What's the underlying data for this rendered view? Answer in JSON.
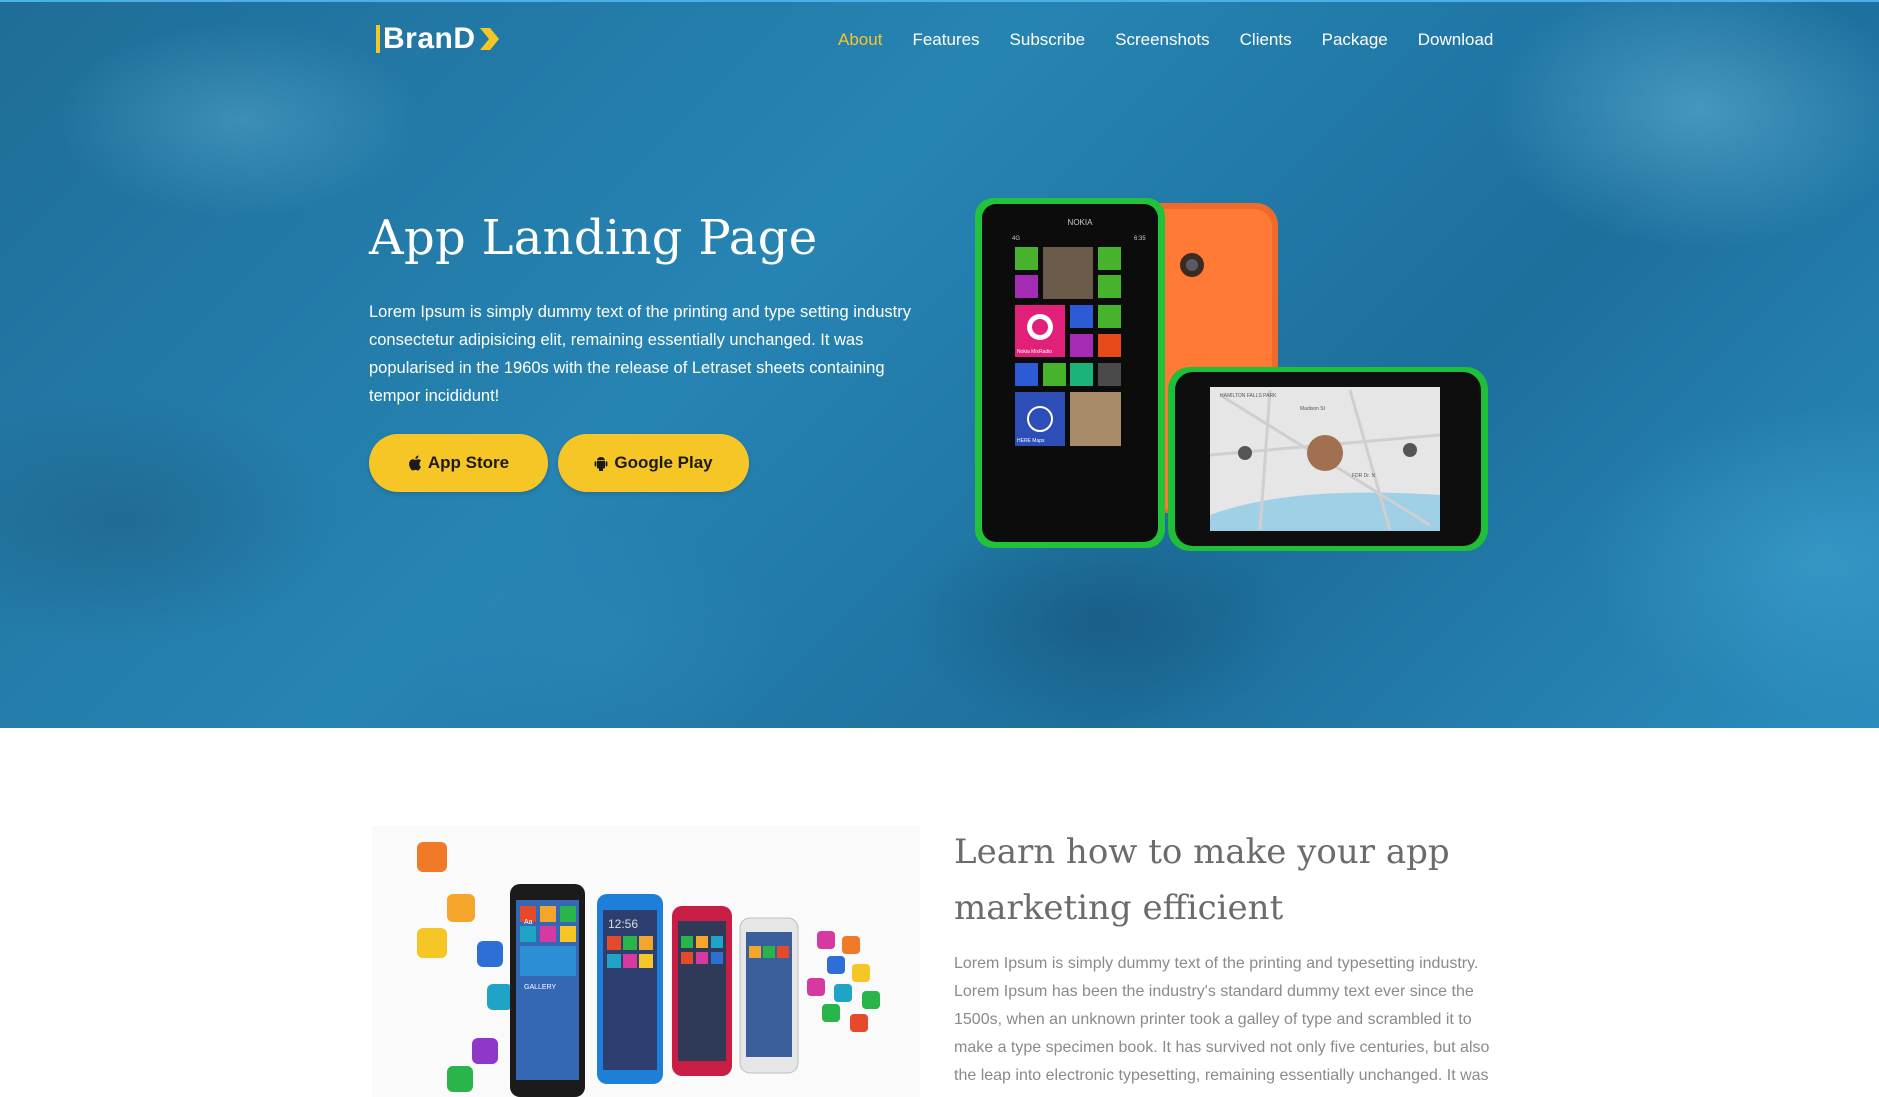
{
  "brand": {
    "logo_text": "BranD",
    "accent": "#f6c626"
  },
  "nav": {
    "items": [
      {
        "label": "About",
        "active": true
      },
      {
        "label": "Features",
        "active": false
      },
      {
        "label": "Subscribe",
        "active": false
      },
      {
        "label": "Screenshots",
        "active": false
      },
      {
        "label": "Clients",
        "active": false
      },
      {
        "label": "Package",
        "active": false
      },
      {
        "label": "Download",
        "active": false
      }
    ]
  },
  "hero": {
    "title": "App Landing Page",
    "text": "Lorem Ipsum is simply dummy text of the printing and type setting industry consectetur adipisicing elit, remaining essentially unchanged. It was popularised in the 1960s with the release of Letraset sheets containing tempor incididunt!",
    "buttons": {
      "app_store": {
        "label": "App Store",
        "icon": "apple-icon"
      },
      "google_play": {
        "label": "Google Play",
        "icon": "android-icon"
      }
    },
    "phone_brand": "NOKIA",
    "tile_labels": {
      "mixradio": "Nokia MixRadio",
      "maps": "HERE Maps"
    },
    "map_labels": [
      "HAMILTON FALLS PARK",
      "FDR Dr. N",
      "Madison St"
    ],
    "phone_status": {
      "signal": "4G",
      "time": "6:35"
    }
  },
  "features_section": {
    "title": "Learn how to make your app marketing efficient",
    "text": "Lorem Ipsum is simply dummy text of the printing and typesetting industry. Lorem Ipsum has been the industry's standard dummy text ever since the 1500s, when an unknown printer took a galley of type and scrambled it to make a type specimen book. It has survived not only five centuries, but also the leap into electronic typesetting, remaining essentially unchanged. It was",
    "image_labels": {
      "clock": "12:56",
      "gallery": "GALLERY",
      "tile_text": "Aa"
    }
  }
}
